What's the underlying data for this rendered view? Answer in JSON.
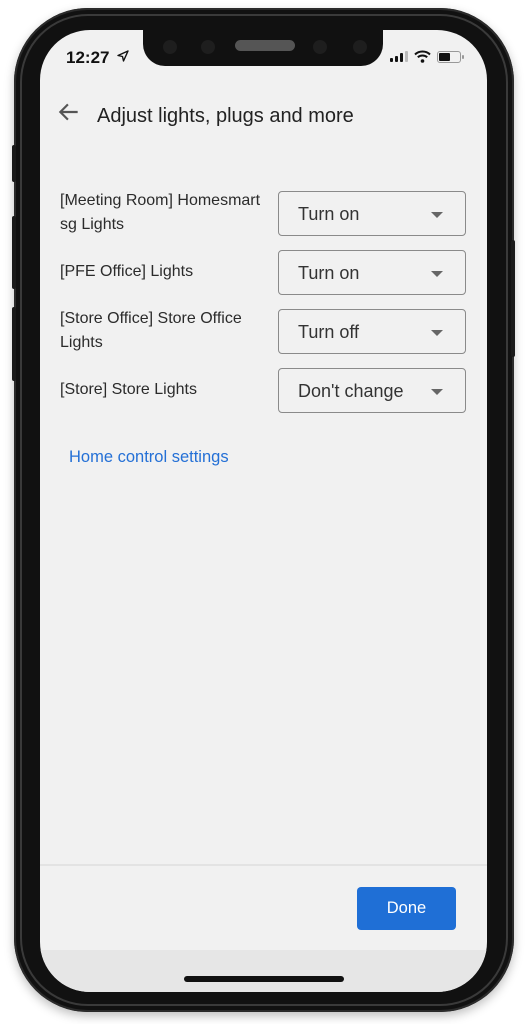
{
  "status_bar": {
    "time": "12:27",
    "location_icon": "location-arrow-icon",
    "signal_icon": "cellular-signal-icon",
    "wifi_icon": "wifi-icon",
    "battery_icon": "battery-icon",
    "battery_level": 0.5
  },
  "header": {
    "back_icon": "arrow-left-icon",
    "title": "Adjust lights, plugs and more"
  },
  "devices": [
    {
      "label": "[Meeting Room] Homesmart sg Lights",
      "action": "Turn on"
    },
    {
      "label": "[PFE Office] Lights",
      "action": "Turn on"
    },
    {
      "label": "[Store Office] Store Office Lights",
      "action": "Turn off"
    },
    {
      "label": "[Store] Store Lights",
      "action": "Don't change"
    }
  ],
  "dropdown_icon": "caret-down-icon",
  "link": {
    "label": "Home control settings"
  },
  "footer": {
    "done_label": "Done"
  },
  "colors": {
    "accent": "#1f6fd6",
    "link": "#2470d6",
    "background": "#f1f1f1"
  }
}
